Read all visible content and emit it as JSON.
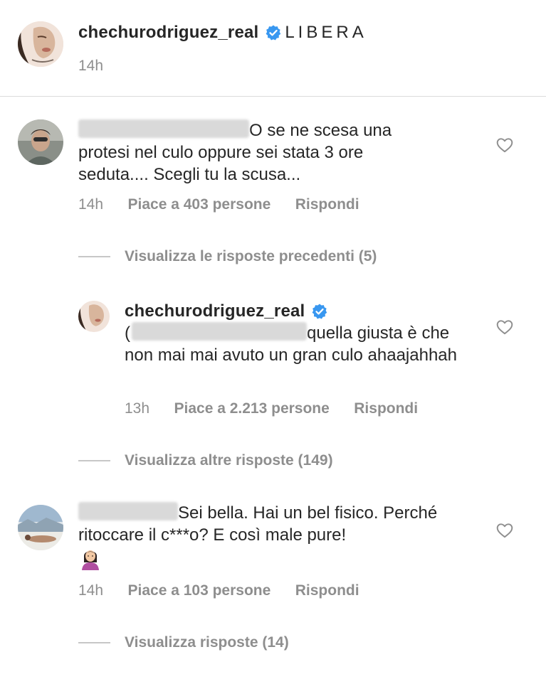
{
  "post": {
    "username": "chechurodriguez_real",
    "caption": "LIBERA",
    "time": "14h"
  },
  "comments": [
    {
      "text": "O se ne scesa una protesi nel culo oppure sei stata 3 ore seduta.... Scegli tu la scusa...",
      "time": "14h",
      "likes": "Piace a 403 persone",
      "reply": "Rispondi",
      "thread_label": "Visualizza le risposte precedenti (5)"
    },
    {
      "username": "chechurodriguez_real",
      "prefix": "(",
      "text": "quella giusta è che non mai mai avuto un gran culo ahaajahhah",
      "time": "13h",
      "likes": "Piace a 2.213 persone",
      "reply": "Rispondi",
      "thread_label": "Visualizza altre risposte (149)"
    },
    {
      "text": "Sei bella. Hai un bel fisico. Perché ritoccare il c***o? E così male pure!",
      "time": "14h",
      "likes": "Piace a 103 persone",
      "reply": "Rispondi",
      "thread_label": "Visualizza risposte (14)"
    }
  ],
  "colors": {
    "verified": "#3897f0",
    "muted": "#8e8e8e",
    "text": "#262626"
  },
  "icons": [
    "verified-badge-icon",
    "heart-icon",
    "woman-emoji-icon"
  ]
}
